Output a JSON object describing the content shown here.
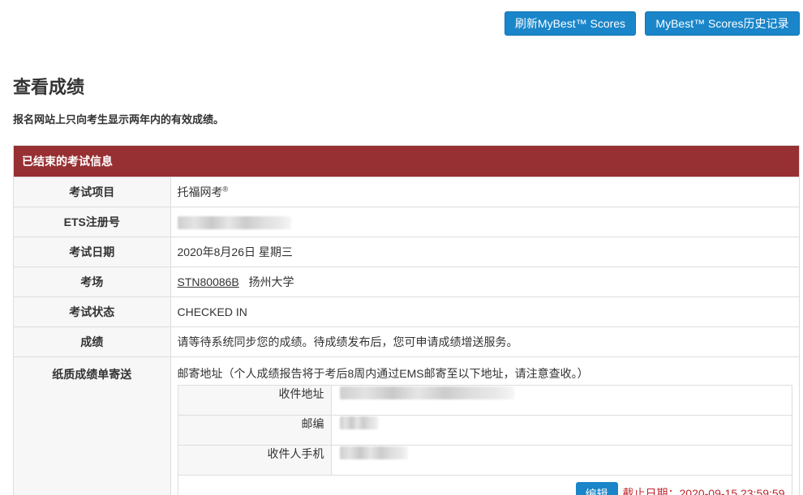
{
  "toolbar": {
    "refresh_label": "刷新MyBest™ Scores",
    "history_label": "MyBest™ Scores历史记录"
  },
  "page": {
    "title": "查看成绩",
    "note": "报名网站上只向考生显示两年内的有效成绩。"
  },
  "panel": {
    "heading": "已结束的考试信息",
    "rows": {
      "exam_item": {
        "label": "考试项目",
        "value": "托福网考",
        "value_sup": "®"
      },
      "ets_id": {
        "label": "ETS注册号"
      },
      "exam_date": {
        "label": "考试日期",
        "value": "2020年8月26日 星期三"
      },
      "center": {
        "label": "考场",
        "code": "STN80086B",
        "name": "扬州大学"
      },
      "status": {
        "label": "考试状态",
        "value": "CHECKED IN"
      },
      "score": {
        "label": "成绩",
        "value": "请等待系统同步您的成绩。待成绩发布后，您可申请成绩增送服务。"
      },
      "mail": {
        "label": "纸质成绩单寄送",
        "intro": "邮寄地址（个人成绩报告将于考后8周内通过EMS邮寄至以下地址，请注意查收。）",
        "address_label": "收件地址",
        "postcode_label": "邮编",
        "phone_label": "收件人手机",
        "edit_label": "编辑",
        "deadline": "截止日期：2020-09-15 23:59:59"
      }
    }
  },
  "colors": {
    "primary_button": "#1a85c9",
    "panel_header": "#973033",
    "deadline_text": "#c0262d"
  }
}
